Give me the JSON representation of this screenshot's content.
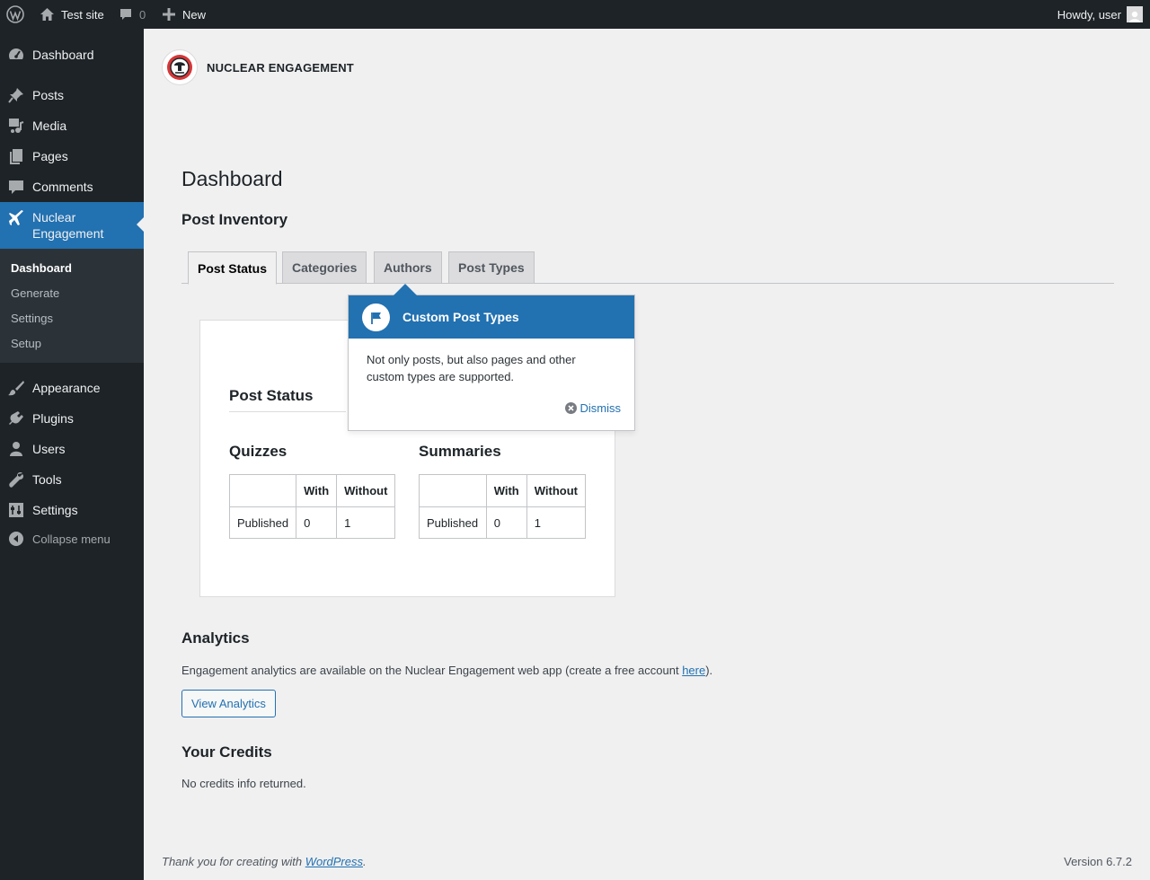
{
  "adminbar": {
    "site_name": "Test site",
    "comments_count": "0",
    "new_label": "New",
    "howdy": "Howdy, user"
  },
  "sidebar": {
    "items": [
      {
        "label": "Dashboard",
        "icon": "dashboard-icon"
      },
      {
        "label": "Posts",
        "icon": "pin-icon"
      },
      {
        "label": "Media",
        "icon": "media-icon"
      },
      {
        "label": "Pages",
        "icon": "pages-icon"
      },
      {
        "label": "Comments",
        "icon": "comment-icon"
      },
      {
        "label": "Nuclear Engagement",
        "icon": "plane-icon",
        "current": true
      },
      {
        "label": "Appearance",
        "icon": "brush-icon"
      },
      {
        "label": "Plugins",
        "icon": "plug-icon"
      },
      {
        "label": "Users",
        "icon": "user-icon"
      },
      {
        "label": "Tools",
        "icon": "wrench-icon"
      },
      {
        "label": "Settings",
        "icon": "settings-icon"
      }
    ],
    "submenu": [
      "Dashboard",
      "Generate",
      "Settings",
      "Setup"
    ],
    "collapse_label": "Collapse menu"
  },
  "brand": {
    "name": "NUCLEAR ENGAGEMENT"
  },
  "main": {
    "title": "Dashboard",
    "inventory_heading": "Post Inventory",
    "tabs": [
      "Post Status",
      "Categories",
      "Authors",
      "Post Types"
    ],
    "card": {
      "title": "Post Status",
      "quizzes": {
        "heading": "Quizzes",
        "headers": [
          "",
          "With",
          "Without"
        ],
        "rows": [
          [
            "Published",
            "0",
            "1"
          ]
        ]
      },
      "summaries": {
        "heading": "Summaries",
        "headers": [
          "",
          "With",
          "Without"
        ],
        "rows": [
          [
            "Published",
            "0",
            "1"
          ]
        ]
      }
    },
    "pointer": {
      "title": "Custom Post Types",
      "text": "Not only posts, but also pages and other custom types are supported.",
      "dismiss": "Dismiss"
    },
    "analytics": {
      "heading": "Analytics",
      "text": "Engagement analytics are available on the Nuclear Engagement web app (create a free account ",
      "link": "here",
      "text_end": ").",
      "button": "View Analytics"
    },
    "credits": {
      "heading": "Your Credits",
      "text": "No credits info returned."
    }
  },
  "footer": {
    "thanks": "Thank you for creating with ",
    "link": "WordPress",
    "period": ".",
    "version": "Version 6.7.2"
  },
  "colors": {
    "accent": "#2271b1",
    "sidebar_bg": "#1d2327",
    "submenu_bg": "#2c3338",
    "page_bg": "#f0f0f1"
  }
}
